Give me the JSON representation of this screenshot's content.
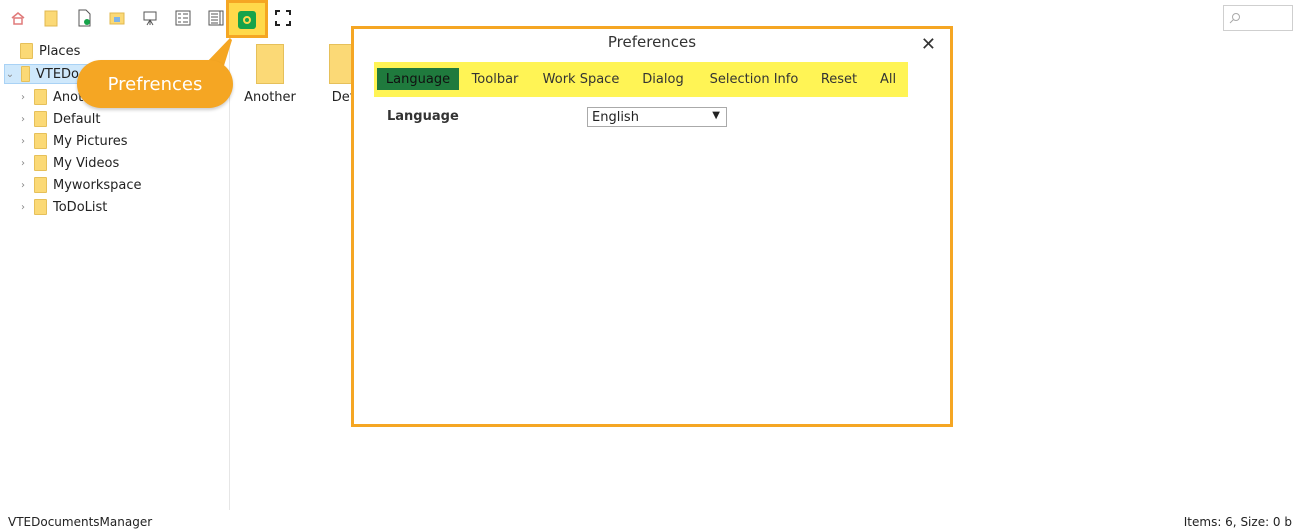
{
  "toolbar": {
    "icons": [
      "home-icon",
      "new-folder-icon",
      "new-file-icon",
      "open-folder-icon",
      "presentation-icon",
      "details-view-icon",
      "list-view-icon",
      "preferences-icon",
      "fullscreen-icon"
    ],
    "search_placeholder": ""
  },
  "tree": {
    "places_label": "Places",
    "root_label": "VTEDo",
    "items": [
      "Anot",
      "Default",
      "My Pictures",
      "My Videos",
      "Myworkspace",
      "ToDoList"
    ]
  },
  "callout": {
    "label": "Prefrences"
  },
  "content": {
    "items": [
      "Another",
      "Def"
    ]
  },
  "dialog": {
    "title": "Preferences",
    "tabs": [
      "Language",
      "Toolbar",
      "Work Space",
      "Dialog",
      "Selection Info",
      "Reset",
      "All"
    ],
    "active_tab": "Language",
    "language_label": "Language",
    "language_value": "English"
  },
  "status": {
    "app_name": "VTEDocumentsManager",
    "summary": "Items: 6, Size: 0 b"
  },
  "colors": {
    "highlight_orange": "#f5a623",
    "tabs_yellow": "#fff455",
    "active_tab_green": "#1f7a3d",
    "folder_yellow": "#fbd976"
  }
}
